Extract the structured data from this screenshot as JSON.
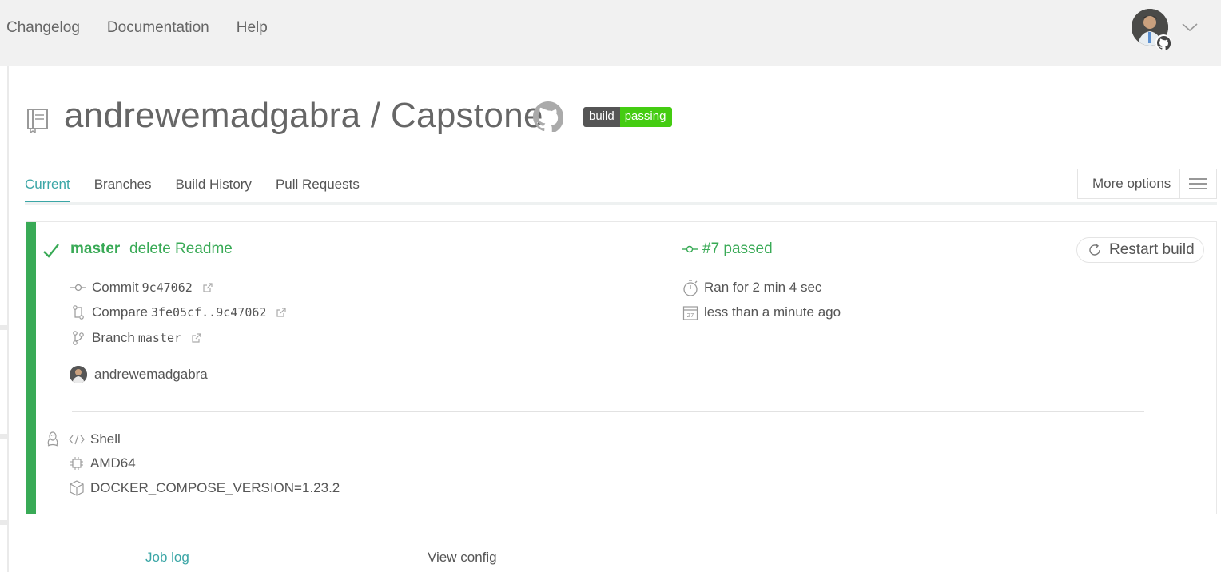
{
  "topnav": {
    "items": [
      "Changelog",
      "Documentation",
      "Help"
    ]
  },
  "repo": {
    "title": "andrewemadgabra / Capstone",
    "badge_left": "build",
    "badge_right": "passing"
  },
  "tabs": [
    "Current",
    "Branches",
    "Build History",
    "Pull Requests"
  ],
  "more_options": "More options",
  "build": {
    "branch": "master",
    "message": "delete Readme",
    "number_status": "#7 passed",
    "restart": "Restart build",
    "commit_label": "Commit",
    "commit_hash": "9c47062",
    "compare_label": "Compare",
    "compare_range": "3fe05cf..9c47062",
    "branch_label": "Branch",
    "branch_value": "master",
    "duration": "Ran for 2 min 4 sec",
    "finished": "less than a minute ago",
    "author": "andrewemadgabra",
    "language": "Shell",
    "arch": "AMD64",
    "env": "DOCKER_COMPOSE_VERSION=1.23.2"
  },
  "bottom": {
    "job_log": "Job log",
    "view_config": "View config"
  },
  "colors": {
    "passed": "#39aa56",
    "accent": "#3ba6a6",
    "badge_green": "#44cc11"
  }
}
